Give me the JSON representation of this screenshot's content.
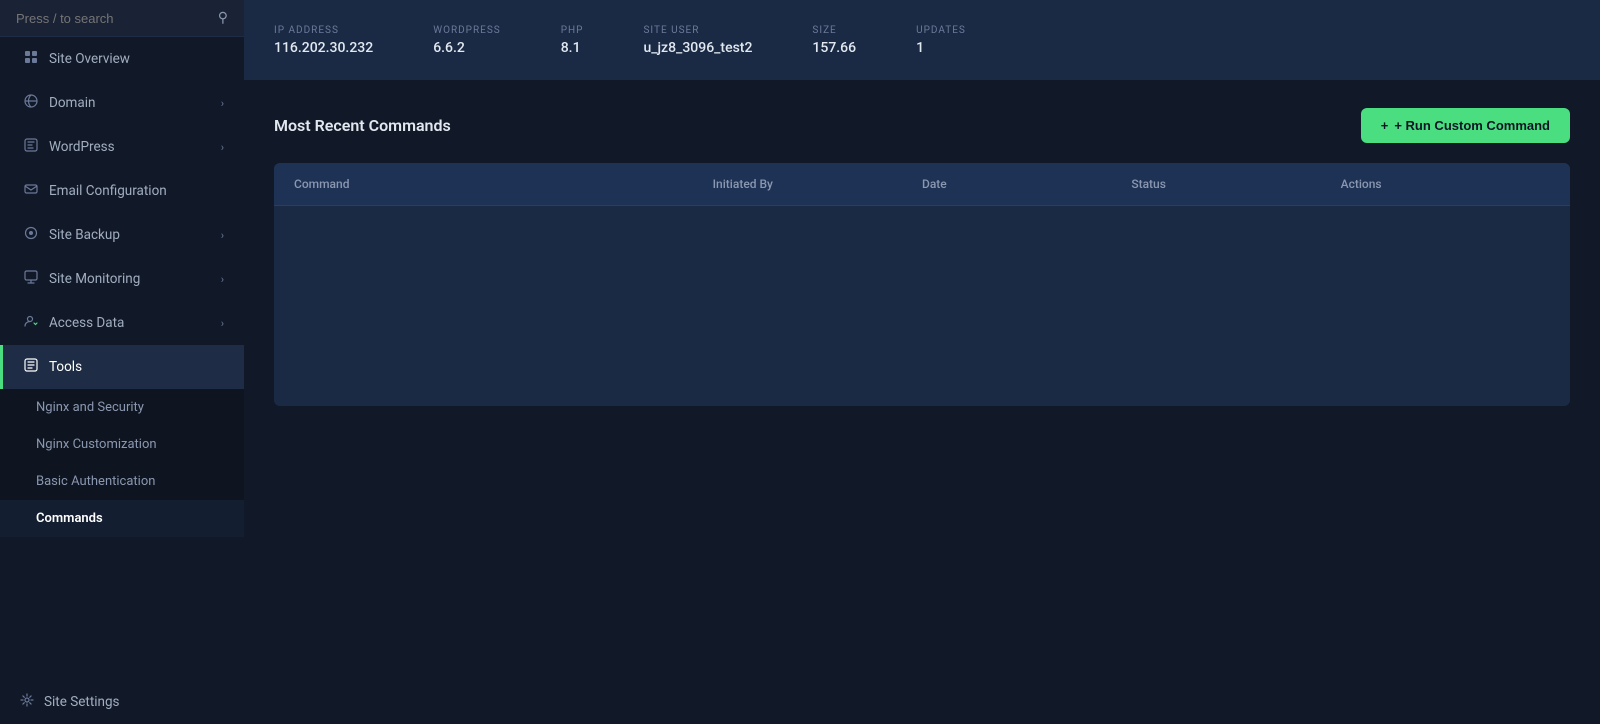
{
  "sidebar": {
    "search": {
      "placeholder": "Press / to search"
    },
    "items": [
      {
        "id": "site-overview",
        "label": "Site Overview",
        "icon": "⊟",
        "hasChevron": false
      },
      {
        "id": "domain",
        "label": "Domain",
        "icon": "🛡",
        "hasChevron": true
      },
      {
        "id": "wordpress",
        "label": "WordPress",
        "icon": "⊟",
        "hasChevron": true
      },
      {
        "id": "email-configuration",
        "label": "Email Configuration",
        "icon": "✉",
        "hasChevron": false
      },
      {
        "id": "site-backup",
        "label": "Site Backup",
        "icon": "◉",
        "hasChevron": true
      },
      {
        "id": "site-monitoring",
        "label": "Site Monitoring",
        "icon": "⊟",
        "hasChevron": true
      },
      {
        "id": "access-data",
        "label": "Access Data",
        "icon": "🔑",
        "hasChevron": true
      },
      {
        "id": "tools",
        "label": "Tools",
        "icon": "⊟",
        "hasChevron": false,
        "active": true
      }
    ],
    "subItems": [
      {
        "id": "nginx-security",
        "label": "Nginx and Security"
      },
      {
        "id": "nginx-customization",
        "label": "Nginx Customization"
      },
      {
        "id": "basic-authentication",
        "label": "Basic Authentication"
      },
      {
        "id": "commands",
        "label": "Commands",
        "active": true
      }
    ],
    "bottomItems": [
      {
        "id": "site-settings",
        "label": "Site Settings",
        "icon": "⚙"
      }
    ]
  },
  "infoBar": {
    "columns": [
      {
        "id": "ip-address",
        "label": "IP ADDRESS",
        "value": "116.202.30.232"
      },
      {
        "id": "wordpress",
        "label": "WORDPRESS",
        "value": "6.6.2"
      },
      {
        "id": "php",
        "label": "PHP",
        "value": "8.1"
      },
      {
        "id": "site-user",
        "label": "SITE USER",
        "value": "u_jz8_3096_test2"
      },
      {
        "id": "size",
        "label": "SIZE",
        "value": "157.66"
      },
      {
        "id": "updates",
        "label": "UPDATES",
        "value": "1"
      }
    ]
  },
  "main": {
    "sectionTitle": "Most Recent Commands",
    "runButton": "+ Run Custom Command",
    "table": {
      "headers": [
        {
          "id": "command",
          "label": "Command"
        },
        {
          "id": "initiated-by",
          "label": "Initiated By"
        },
        {
          "id": "date",
          "label": "Date"
        },
        {
          "id": "status",
          "label": "Status"
        },
        {
          "id": "actions",
          "label": "Actions"
        }
      ],
      "rows": []
    }
  }
}
